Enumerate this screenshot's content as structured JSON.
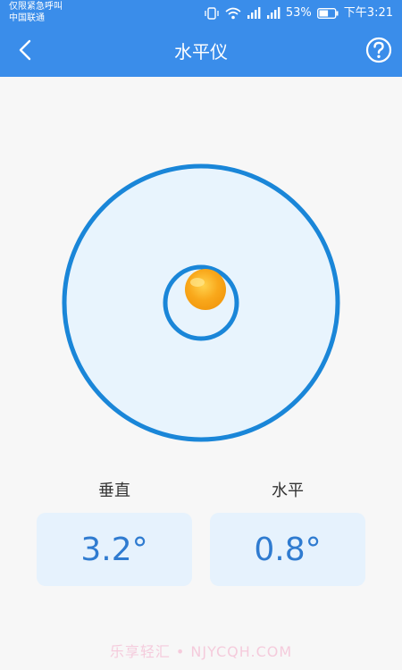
{
  "status_bar": {
    "carrier_line1": "仅限紧急呼叫",
    "carrier_line2": "中国联通",
    "battery_percent": "53%",
    "time": "下午3:21",
    "icons": [
      "vibrate-icon",
      "wifi-icon",
      "signal-icon",
      "signal-icon",
      "battery-icon"
    ]
  },
  "app_bar": {
    "title": "水平仪",
    "back_icon": "chevron-left-icon",
    "help_icon": "question-circle-icon"
  },
  "level": {
    "vertical_label": "垂直",
    "vertical_value": "3.2°",
    "horizontal_label": "水平",
    "horizontal_value": "0.8°"
  },
  "colors": {
    "primary": "#3a8dea",
    "ring": "#1a86d8",
    "bubble": "#f8a61a",
    "value_text": "#2f7bd0",
    "value_bg": "#e6f2fd"
  },
  "watermark": "乐享轻汇 • NJYCQH.COM"
}
